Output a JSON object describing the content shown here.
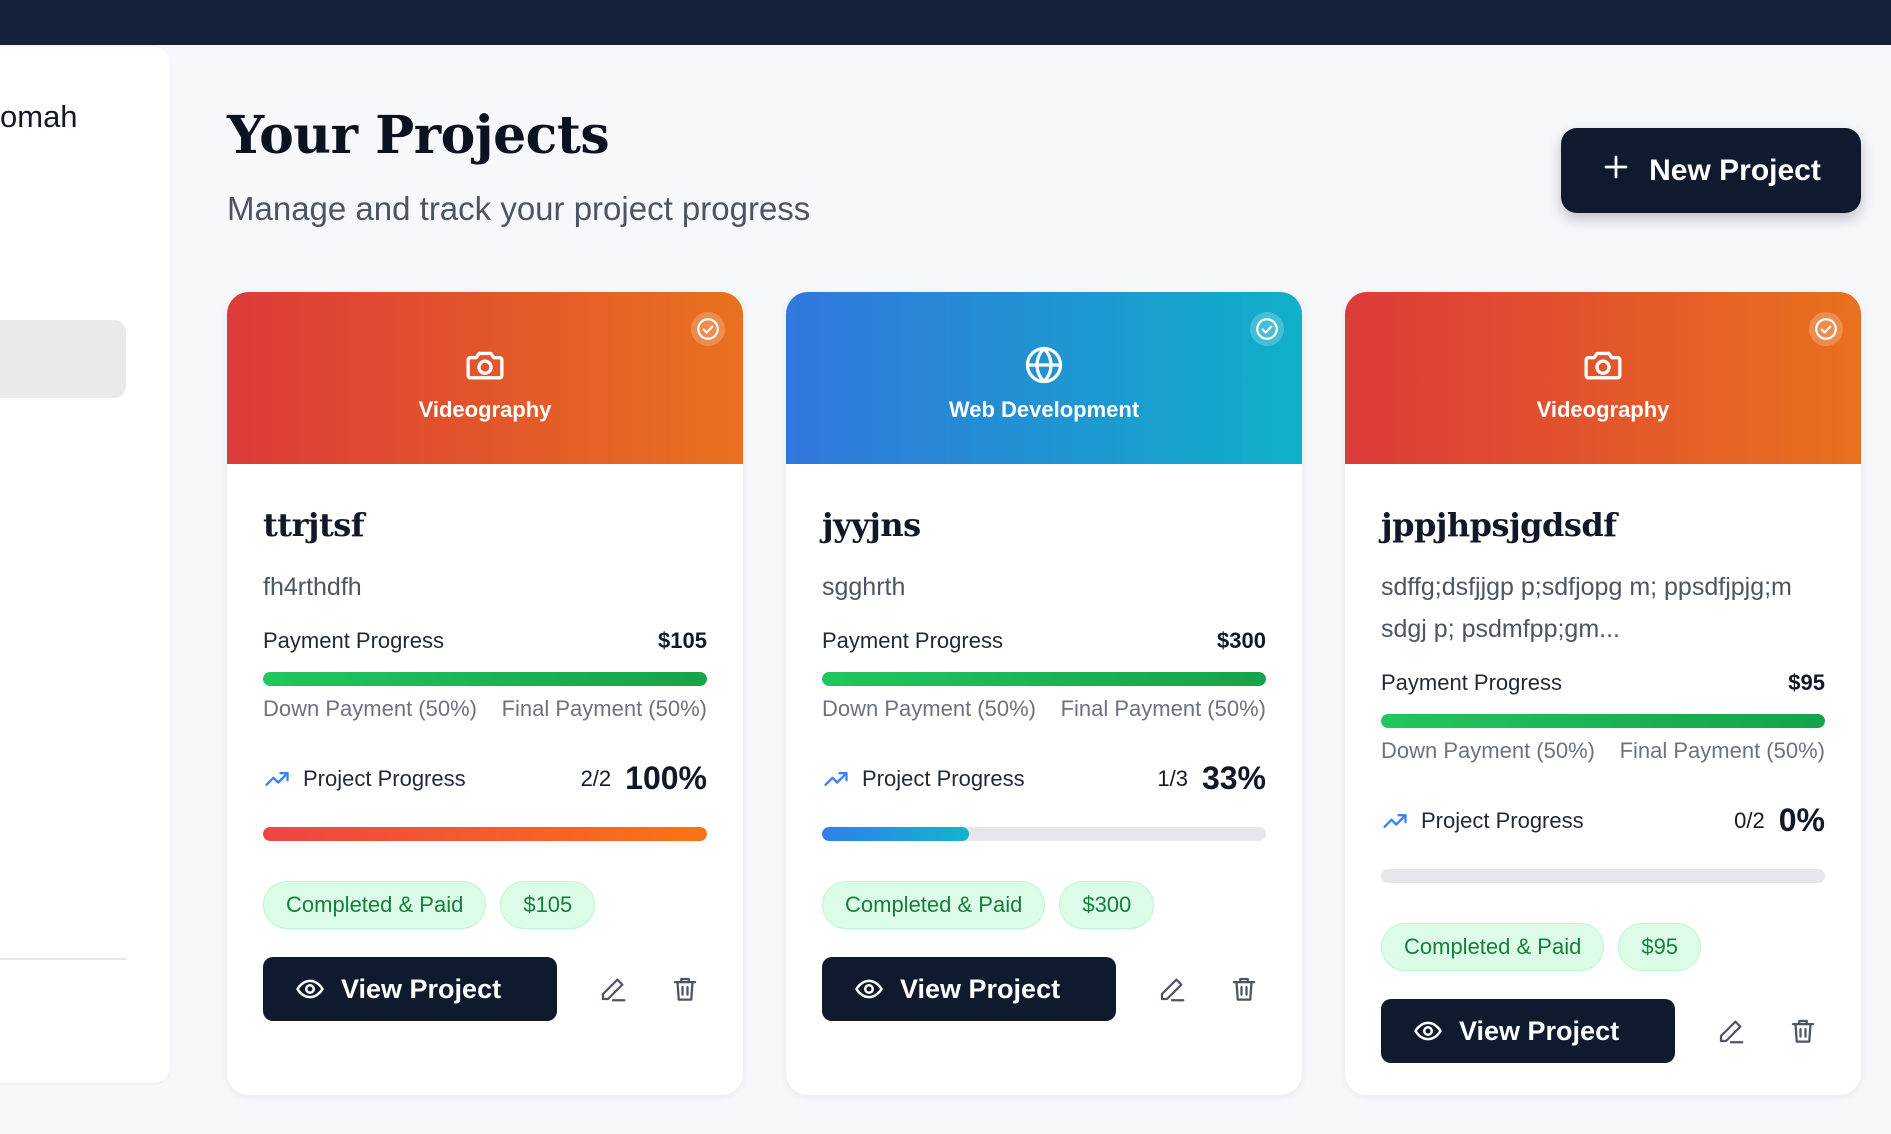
{
  "sidebar": {
    "user_name": "omah"
  },
  "header": {
    "title": "Your Projects",
    "subtitle": "Manage and track your project progress",
    "new_project_label": "New Project"
  },
  "colors": {
    "topbar": "#16213a",
    "primary_button": "#0f1a2e",
    "badge_green": "#dcfce7",
    "badge_text": "#15803d"
  },
  "projects": [
    {
      "category": "Videography",
      "category_icon": "camera-icon",
      "title": "ttrjtsf",
      "description": "fh4rthdfh",
      "payment_label": "Payment Progress",
      "payment_amount": "$105",
      "payment_progress": 1.0,
      "down_payment_label": "Down Payment (50%)",
      "final_payment_label": "Final Payment (50%)",
      "project_label": "Project Progress",
      "project_count": "2/2",
      "project_percent": "100%",
      "project_progress": 1.0,
      "status_label": "Completed & Paid",
      "amount_badge": "$105",
      "view_label": "View Project"
    },
    {
      "category": "Web Development",
      "category_icon": "globe-icon",
      "title": "jyyjns",
      "description": "sgghrth",
      "payment_label": "Payment Progress",
      "payment_amount": "$300",
      "payment_progress": 1.0,
      "down_payment_label": "Down Payment (50%)",
      "final_payment_label": "Final Payment (50%)",
      "project_label": "Project Progress",
      "project_count": "1/3",
      "project_percent": "33%",
      "project_progress": 0.33,
      "status_label": "Completed & Paid",
      "amount_badge": "$300",
      "view_label": "View Project"
    },
    {
      "category": "Videography",
      "category_icon": "camera-icon",
      "title": "jppjhpsjgdsdf",
      "description": "sdffg;dsfjjgp p;sdfjopg m; ppsdfjpjg;m sdgj p; psdmfpp;gm...",
      "payment_label": "Payment Progress",
      "payment_amount": "$95",
      "payment_progress": 1.0,
      "down_payment_label": "Down Payment (50%)",
      "final_payment_label": "Final Payment (50%)",
      "project_label": "Project Progress",
      "project_count": "0/2",
      "project_percent": "0%",
      "project_progress": 0.0,
      "status_label": "Completed & Paid",
      "amount_badge": "$95",
      "view_label": "View Project"
    }
  ]
}
